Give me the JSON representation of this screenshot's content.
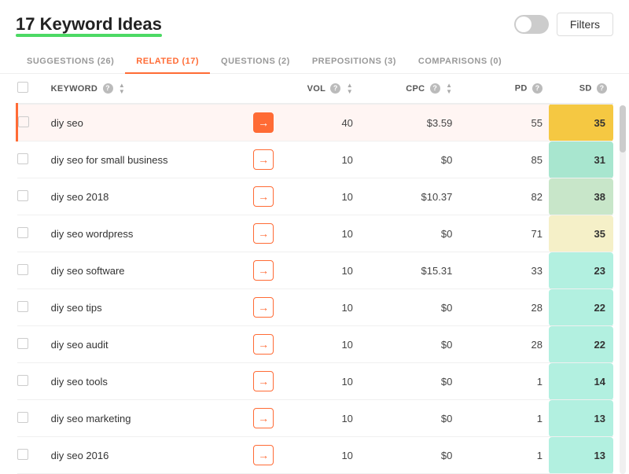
{
  "header": {
    "title": "17 Keyword Ideas",
    "toggle_label": "toggle",
    "filters_label": "Filters"
  },
  "tabs": [
    {
      "id": "suggestions",
      "label": "SUGGESTIONS (26)",
      "active": false
    },
    {
      "id": "related",
      "label": "RELATED (17)",
      "active": true
    },
    {
      "id": "questions",
      "label": "QUESTIONS (2)",
      "active": false
    },
    {
      "id": "prepositions",
      "label": "PREPOSITIONS (3)",
      "active": false
    },
    {
      "id": "comparisons",
      "label": "COMPARISONS (0)",
      "active": false
    }
  ],
  "table": {
    "columns": [
      {
        "id": "keyword",
        "label": "KEYWORD"
      },
      {
        "id": "vol",
        "label": "VOL"
      },
      {
        "id": "cpc",
        "label": "CPC"
      },
      {
        "id": "pd",
        "label": "PD"
      },
      {
        "id": "sd",
        "label": "SD"
      }
    ],
    "rows": [
      {
        "keyword": "diy seo",
        "vol": "40",
        "cpc": "$3.59",
        "pd": "55",
        "sd": "35",
        "sd_color": "#f5c842",
        "selected": true
      },
      {
        "keyword": "diy seo for small business",
        "vol": "10",
        "cpc": "$0",
        "pd": "85",
        "sd": "31",
        "sd_color": "#a8e6cf",
        "selected": false
      },
      {
        "keyword": "diy seo 2018",
        "vol": "10",
        "cpc": "$10.37",
        "pd": "82",
        "sd": "38",
        "sd_color": "#c8e6c9",
        "selected": false
      },
      {
        "keyword": "diy seo wordpress",
        "vol": "10",
        "cpc": "$0",
        "pd": "71",
        "sd": "35",
        "sd_color": "#f5f0c8",
        "selected": false
      },
      {
        "keyword": "diy seo software",
        "vol": "10",
        "cpc": "$15.31",
        "pd": "33",
        "sd": "23",
        "sd_color": "#b2f0e0",
        "selected": false
      },
      {
        "keyword": "diy seo tips",
        "vol": "10",
        "cpc": "$0",
        "pd": "28",
        "sd": "22",
        "sd_color": "#b2f0e0",
        "selected": false
      },
      {
        "keyword": "diy seo audit",
        "vol": "10",
        "cpc": "$0",
        "pd": "28",
        "sd": "22",
        "sd_color": "#b2f0e0",
        "selected": false
      },
      {
        "keyword": "diy seo tools",
        "vol": "10",
        "cpc": "$0",
        "pd": "1",
        "sd": "14",
        "sd_color": "#b2f0e0",
        "selected": false
      },
      {
        "keyword": "diy seo marketing",
        "vol": "10",
        "cpc": "$0",
        "pd": "1",
        "sd": "13",
        "sd_color": "#b2f0e0",
        "selected": false
      },
      {
        "keyword": "diy seo 2016",
        "vol": "10",
        "cpc": "$0",
        "pd": "1",
        "sd": "13",
        "sd_color": "#b2f0e0",
        "selected": false
      }
    ]
  }
}
